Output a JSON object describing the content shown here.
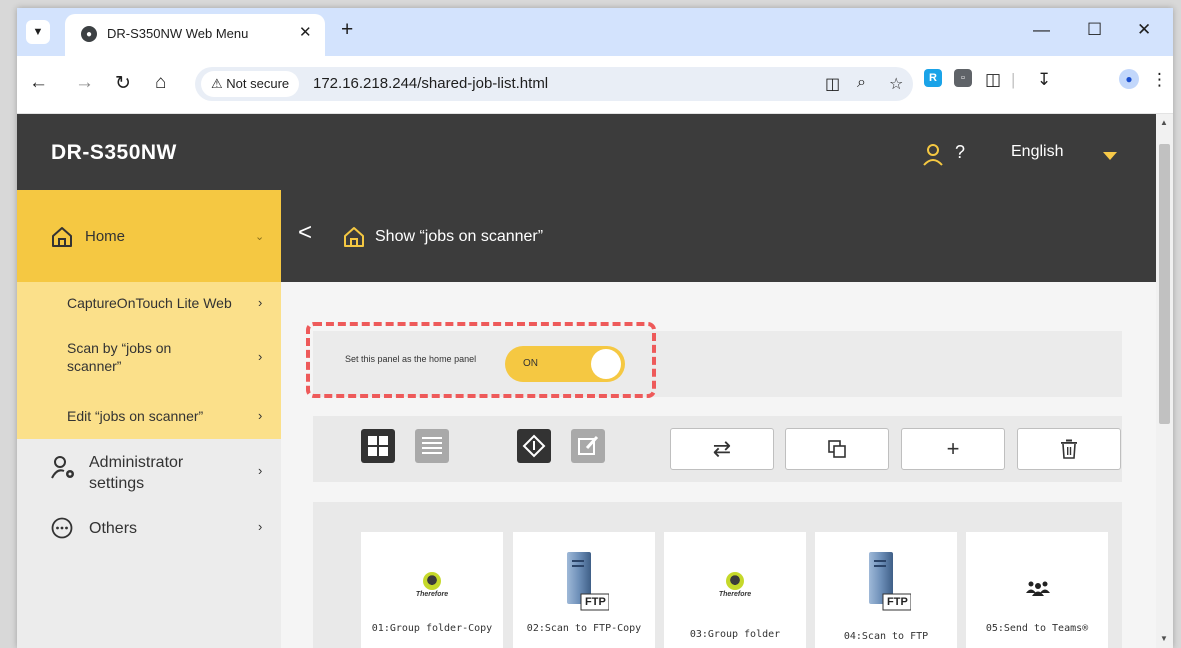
{
  "browser": {
    "tab_title": "DR-S350NW Web Menu",
    "tab_close": "✕",
    "new_tab": "+",
    "minimize": "—",
    "maximize": "☐",
    "close": "✕",
    "security_chip": "⚠ Not secure",
    "url": "172.16.218.244/shared-job-list.html"
  },
  "header": {
    "brand": "DR-S350NW",
    "help": "?",
    "language": "English"
  },
  "sidebar": {
    "home": "Home",
    "sub_items": [
      {
        "label": "CaptureOnTouch Lite Web"
      },
      {
        "label": "Scan by “jobs on scanner”"
      },
      {
        "label": "Edit “jobs on scanner”"
      }
    ],
    "admin": "Administrator settings",
    "others": "Others"
  },
  "content": {
    "back": "<",
    "title": "Show “jobs on scanner”"
  },
  "home_panel": {
    "label": "Set this panel as the home panel",
    "toggle_state": "ON"
  },
  "jobs": [
    {
      "name": "01:Group folder-Copy",
      "icon": "therefore-icon",
      "icon_text": "Therefore"
    },
    {
      "name": "02:Scan to FTP-Copy",
      "icon": "ftp-server-icon",
      "icon_text": "FTP"
    },
    {
      "name": "03:Group folder",
      "icon": "therefore-icon",
      "icon_text": "Therefore"
    },
    {
      "name": "04:Scan to FTP",
      "icon": "ftp-server-icon",
      "icon_text": "FTP"
    },
    {
      "name": "05:Send to Teams®",
      "icon": "team-icon"
    }
  ],
  "colors": {
    "accent": "#f5c842",
    "accent_light": "#fbe08a",
    "header_dark": "#3c3c3c",
    "highlight_dashes": "#ee5a5a"
  }
}
